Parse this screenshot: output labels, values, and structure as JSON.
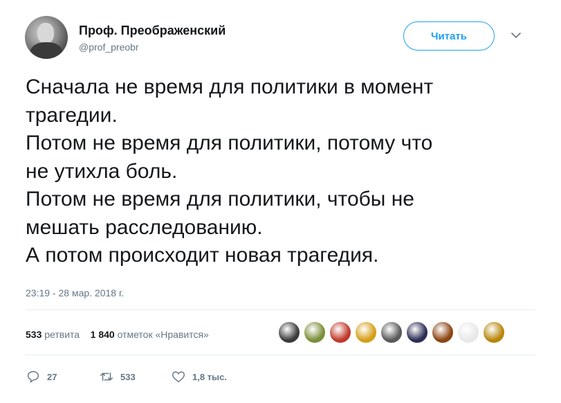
{
  "author": {
    "name": "Проф. Преображенский",
    "handle": "@prof_preobr"
  },
  "follow_button": {
    "label": "Читать"
  },
  "more_menu": {
    "icon": "chevron-down-icon"
  },
  "tweet": {
    "lines": [
      "Сначала не время для политики в момент",
      "трагедии.",
      "Потом не время для политики, потому что",
      "не утихла боль.",
      "Потом не время для политики, чтобы не",
      "мешать расследованию.",
      "А потом происходит новая трагедия."
    ],
    "timestamp": "23:19 - 28 мар. 2018 г."
  },
  "stats": {
    "retweets_count": "533",
    "retweets_label": "ретвита",
    "likes_count": "1 840",
    "likes_label": "отметок «Нравится»"
  },
  "likers": {
    "count_shown": 9,
    "colors": [
      "#3b3b3b",
      "#7b8f3a",
      "#c0392b",
      "#d4a017",
      "#5a5a5a",
      "#2c2c54",
      "#8b4513",
      "#e8e8e8",
      "#b8860b"
    ]
  },
  "actions": {
    "reply_count": "27",
    "retweet_count": "533",
    "like_count": "1,8 тыс.",
    "icons": [
      "reply-icon",
      "retweet-icon",
      "heart-icon"
    ]
  },
  "colors": {
    "accent": "#1da1f2",
    "secondary_text": "#657786",
    "primary_text": "#14171a",
    "divider": "#e6ecf0"
  }
}
